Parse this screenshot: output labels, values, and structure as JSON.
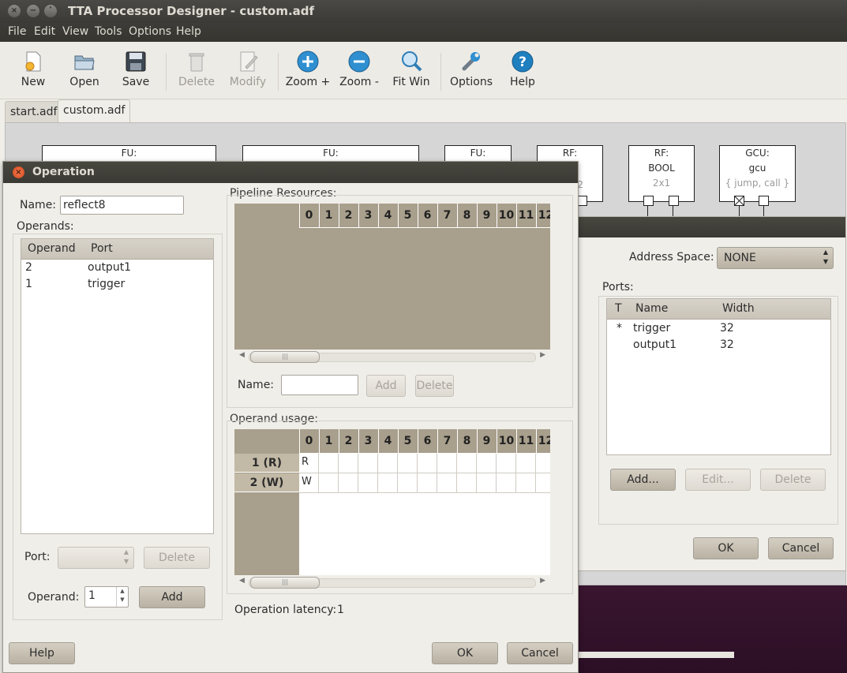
{
  "window": {
    "title": "TTA Processor Designer - custom.adf",
    "controls": [
      "×",
      "−",
      "˄"
    ]
  },
  "menubar": [
    "File",
    "Edit",
    "View",
    "Tools",
    "Options",
    "Help"
  ],
  "toolbar": {
    "buttons": [
      {
        "label": "New",
        "icon": "new-document-icon",
        "enabled": true
      },
      {
        "label": "Open",
        "icon": "open-folder-icon",
        "enabled": true
      },
      {
        "label": "Save",
        "icon": "save-floppy-icon",
        "enabled": true
      },
      {
        "label": "Delete",
        "icon": "trash-icon",
        "enabled": false
      },
      {
        "label": "Modify",
        "icon": "edit-document-icon",
        "enabled": false
      },
      {
        "label": "Zoom +",
        "icon": "zoom-in-icon",
        "enabled": true
      },
      {
        "label": "Zoom -",
        "icon": "zoom-out-icon",
        "enabled": true
      },
      {
        "label": "Fit Win",
        "icon": "fit-window-icon",
        "enabled": true
      },
      {
        "label": "Options",
        "icon": "wrench-icon",
        "enabled": true
      },
      {
        "label": "Help",
        "icon": "help-icon",
        "enabled": true
      }
    ]
  },
  "tabs": [
    "start.adf",
    "custom.adf"
  ],
  "canvas": {
    "units": [
      {
        "lines": [
          "FU:"
        ]
      },
      {
        "lines": [
          "FU:"
        ]
      },
      {
        "lines": [
          "FU:"
        ]
      },
      {
        "lines": [
          "RF:"
        ],
        "partial": "2"
      },
      {
        "lines": [
          "RF:",
          "BOOL"
        ],
        "sub": "2x1"
      },
      {
        "lines": [
          "GCU:",
          "gcu"
        ],
        "sub": "{ jump, call }"
      }
    ]
  },
  "fu_dialog": {
    "address_space_label": "Address Space:",
    "address_space_value": "NONE",
    "ports_label": "Ports:",
    "ports_headers": [
      "T",
      "Name",
      "Width"
    ],
    "ports": [
      {
        "t": "*",
        "name": "trigger",
        "width": "32"
      },
      {
        "t": "",
        "name": "output1",
        "width": "32"
      }
    ],
    "buttons": {
      "add": "Add...",
      "edit": "Edit...",
      "delete": "Delete",
      "ok": "OK",
      "cancel": "Cancel"
    }
  },
  "op_dialog": {
    "title": "Operation",
    "name_label": "Name:",
    "name_value": "reflect8",
    "operands_label": "Operands:",
    "operands_headers": [
      "Operand",
      "Port"
    ],
    "operands": [
      {
        "operand": "2",
        "port": "output1"
      },
      {
        "operand": "1",
        "port": "trigger"
      }
    ],
    "port_label": "Port:",
    "port_delete": "Delete",
    "operand_label": "Operand:",
    "operand_value": "1",
    "operand_add": "Add",
    "pipeline_label": "Pipeline Resources:",
    "cycles": [
      "0",
      "1",
      "2",
      "3",
      "4",
      "5",
      "6",
      "7",
      "8",
      "9",
      "10",
      "11",
      "12"
    ],
    "resource_name_label": "Name:",
    "resource_add": "Add",
    "resource_delete": "Delete",
    "usage_label": "Operand usage:",
    "usage_rows": [
      {
        "label": "1 (R)",
        "cells": [
          "R"
        ]
      },
      {
        "label": "2 (W)",
        "cells": [
          "W"
        ]
      }
    ],
    "latency_label": "Operation latency:",
    "latency_value": "1",
    "help": "Help",
    "ok": "OK",
    "cancel": "Cancel"
  }
}
